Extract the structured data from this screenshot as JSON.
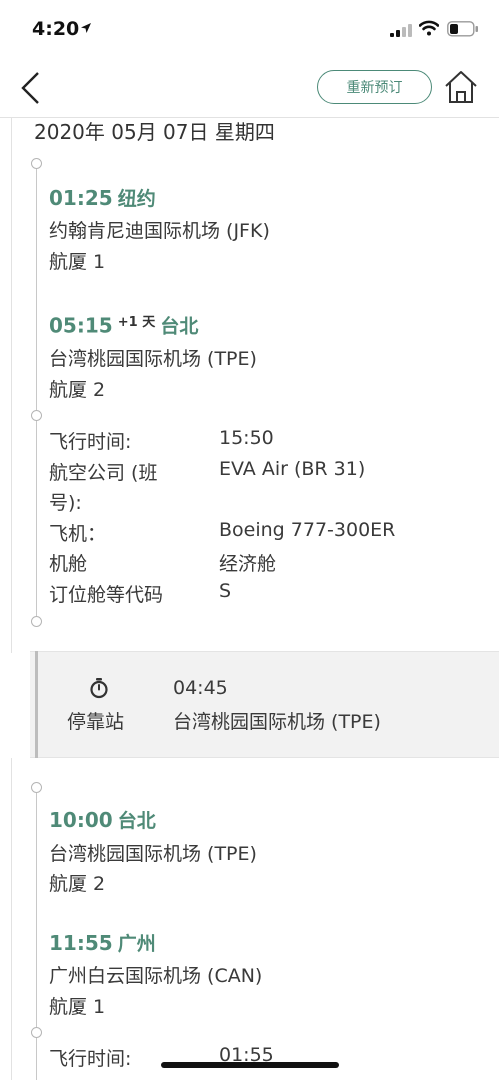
{
  "status_bar": {
    "time": "4:20"
  },
  "nav": {
    "rebook_label": "重新预订"
  },
  "date": "2020年 05月 07日 星期四",
  "segments": [
    {
      "depart": {
        "time": "01:25",
        "city": "纽约",
        "airport": "约翰肯尼迪国际机场 (JFK)",
        "terminal": "航厦 1"
      },
      "arrive": {
        "time": "05:15",
        "day_offset": "+1 天",
        "city": "台北",
        "airport": "台湾桃园国际机场 (TPE)",
        "terminal": "航厦 2"
      },
      "details": {
        "flight_time_label": "飞行时间:",
        "flight_time": "15:50",
        "airline_label_1": "航空公司 (班",
        "airline_label_2": "号):",
        "airline": "EVA Air (BR 31)",
        "aircraft_label": "飞机：",
        "aircraft": "Boeing 777-300ER",
        "cabin_label": "机舱",
        "cabin": "经济舱",
        "booking_class_label": "订位舱等代码",
        "booking_class": "S"
      }
    },
    {
      "depart": {
        "time": "10:00",
        "city": "台北",
        "airport": "台湾桃园国际机场 (TPE)",
        "terminal": "航厦 2"
      },
      "arrive": {
        "time": "11:55",
        "city": "广州",
        "airport": "广州白云国际机场 (CAN)",
        "terminal": "航厦 1"
      },
      "details": {
        "flight_time_label": "飞行时间:",
        "flight_time": "01:55"
      }
    }
  ],
  "layover": {
    "label": "停靠站",
    "duration": "04:45",
    "airport": "台湾桃园国际机场 (TPE)",
    "icon": "stopwatch-icon"
  },
  "colors": {
    "accent": "#4f8a77",
    "layover_bg": "#f2f2f2"
  }
}
